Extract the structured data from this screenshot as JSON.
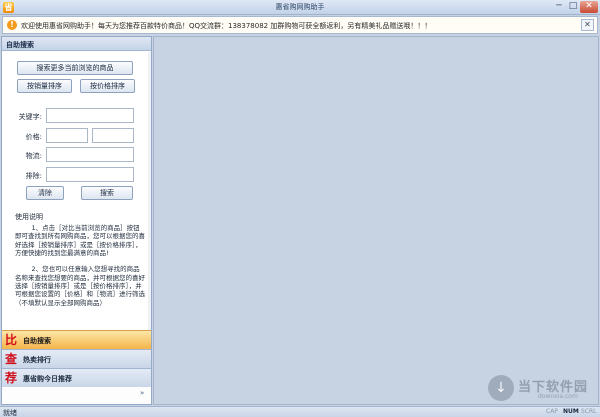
{
  "window": {
    "title": "惠省购网购助手",
    "app_icon_glyph": "省",
    "min_glyph": "─",
    "max_glyph": "□",
    "close_glyph": "✕"
  },
  "notice": {
    "icon_glyph": "!",
    "text": "欢迎使用惠省网购助手！每天为您推荐百款特价商品！QQ交流群：138378082 加群购物可获全额返利，另有精美礼品赠送哦！！！",
    "close_glyph": "✕"
  },
  "panel": {
    "header": "自助搜索",
    "search_more_label": "搜索更多当前浏览的商品",
    "sort_sales_label": "按销量排序",
    "sort_price_label": "按价格排序",
    "keyword_label": "关键字:",
    "price_label": "价格:",
    "logistics_label": "物流:",
    "exclude_label": "排除:",
    "keyword_value": "",
    "price_min_value": "",
    "price_max_value": "",
    "logistics_value": "",
    "exclude_value": "",
    "clear_label": "清除",
    "search_label": "搜索",
    "help_title": "使用说明",
    "help_text": "        1、点击［对比当前浏览的商品］按钮即可查找到所有网购商品，您可以根据您的喜好选择［按销量排序］或是［按价格排序］，方便快捷的找到您最满意的商品!\n\n        2、您也可以任意输入您想寻找的商品名称来查找您想要的商品，并可根据您的喜好选择［按销量排序］或是［按价格排序］，并可根据您设置的［价格］和［物流］进行筛选（不填默认显示全部网购商品）"
  },
  "nav": [
    {
      "icon": "比",
      "label": "自助搜索",
      "active": true
    },
    {
      "icon": "查",
      "label": "热卖排行",
      "active": false
    },
    {
      "icon": "荐",
      "label": "惠省购今日推荐",
      "active": false
    }
  ],
  "nav_chevron": "»",
  "watermark": {
    "glyph": "↓",
    "title": "当下软件园",
    "sub": "downxia.com"
  },
  "status": {
    "text": "就绪",
    "caps": "CAP",
    "num": "NUM",
    "scrl": "SCRL"
  }
}
